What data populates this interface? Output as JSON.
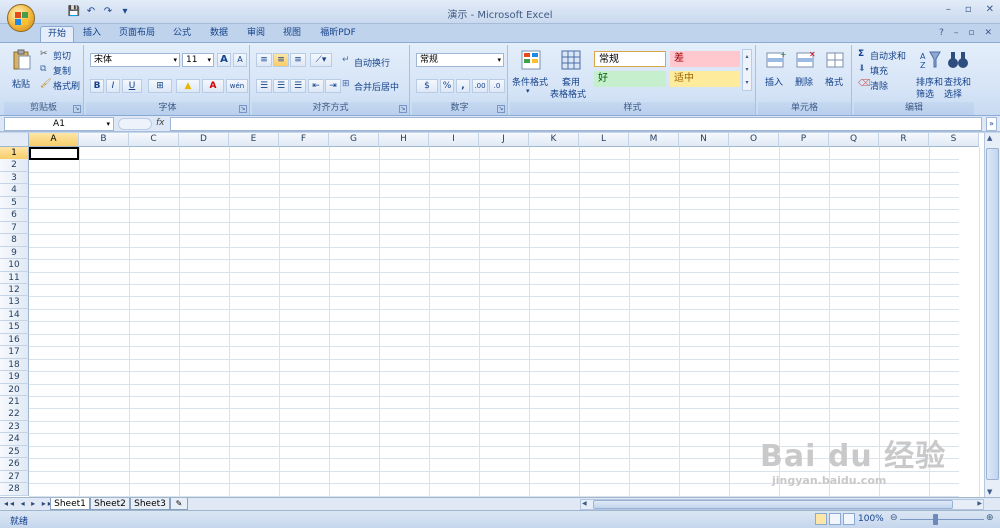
{
  "app": {
    "title": "演示 - Microsoft Excel",
    "qat": {
      "save": "💾",
      "undo": "↶",
      "redo": "↷",
      "customize": "▾"
    },
    "window": {
      "min": "–",
      "max": "▫",
      "close": "✕"
    },
    "ribbon_right": {
      "help": "?",
      "min": "–",
      "restore": "▫",
      "close": "✕"
    }
  },
  "tabs": [
    {
      "label": "开始",
      "active": true
    },
    {
      "label": "插入"
    },
    {
      "label": "页面布局"
    },
    {
      "label": "公式"
    },
    {
      "label": "数据"
    },
    {
      "label": "审阅"
    },
    {
      "label": "视图"
    },
    {
      "label": "福昕PDF"
    }
  ],
  "ribbon": {
    "clipboard": {
      "label": "剪贴板",
      "paste": "粘贴",
      "cut": "剪切",
      "copy": "复制",
      "format_painter": "格式刷"
    },
    "font": {
      "label": "字体",
      "name": "宋体",
      "size": "11",
      "grow": "A",
      "shrink": "A",
      "bold": "B",
      "italic": "I",
      "underline": "U",
      "border": "⊞",
      "fill": "▲",
      "color": "A",
      "phonetic": "wén"
    },
    "alignment": {
      "label": "对齐方式",
      "wrap": "自动换行",
      "merge": "合并后居中"
    },
    "number": {
      "label": "数字",
      "format": "常规",
      "currency": "$",
      "percent": "%",
      "comma": ",",
      "inc_decimal": ".00",
      "dec_decimal": ".0"
    },
    "styles": {
      "label": "样式",
      "conditional": "条件格式",
      "table_format_1": "套用",
      "table_format_2": "表格格式",
      "cell_styles": [
        {
          "name": "常规",
          "bg": "#ffffff",
          "fg": "#000000"
        },
        {
          "name": "差",
          "bg": "#ffc7ce",
          "fg": "#9c0006"
        },
        {
          "name": "好",
          "bg": "#c6efce",
          "fg": "#006100"
        },
        {
          "name": "适中",
          "bg": "#ffeb9c",
          "fg": "#9c6500"
        }
      ]
    },
    "cells": {
      "label": "单元格",
      "insert": "插入",
      "delete": "删除",
      "format": "格式"
    },
    "editing": {
      "label": "编辑",
      "autosum": "自动求和",
      "fill": "填充",
      "clear": "清除",
      "sort_1": "排序和",
      "sort_2": "筛选",
      "find_1": "查找和",
      "find_2": "选择"
    }
  },
  "formula_bar": {
    "name_box": "A1",
    "fx": "fx",
    "value": ""
  },
  "grid": {
    "columns": [
      "A",
      "B",
      "C",
      "D",
      "E",
      "F",
      "G",
      "H",
      "I",
      "J",
      "K",
      "L",
      "M",
      "N",
      "O",
      "P",
      "Q",
      "R",
      "S"
    ],
    "rows": [
      "1",
      "2",
      "3",
      "4",
      "5",
      "6",
      "7",
      "8",
      "9",
      "10",
      "11",
      "12",
      "13",
      "14",
      "15",
      "16",
      "17",
      "18",
      "19",
      "20",
      "21",
      "22",
      "23",
      "24",
      "25",
      "26",
      "27",
      "28"
    ],
    "selected_cell": "A1"
  },
  "sheets": {
    "nav": "◂◂ ◂ ▸ ▸▸",
    "tabs": [
      {
        "label": "Sheet1",
        "active": true
      },
      {
        "label": "Sheet2"
      },
      {
        "label": "Sheet3"
      }
    ],
    "new_sheet": "✎"
  },
  "status": {
    "text": "就绪",
    "zoom": "100%",
    "zoom_out": "⊖",
    "zoom_in": "⊕"
  },
  "watermark": {
    "line1": "Bai du 经验",
    "line2": "jingyan.baidu.com"
  },
  "colors": {
    "accent": "#15428b",
    "ribbon": "#d4e3f6",
    "selection": "#f8cd6b"
  }
}
